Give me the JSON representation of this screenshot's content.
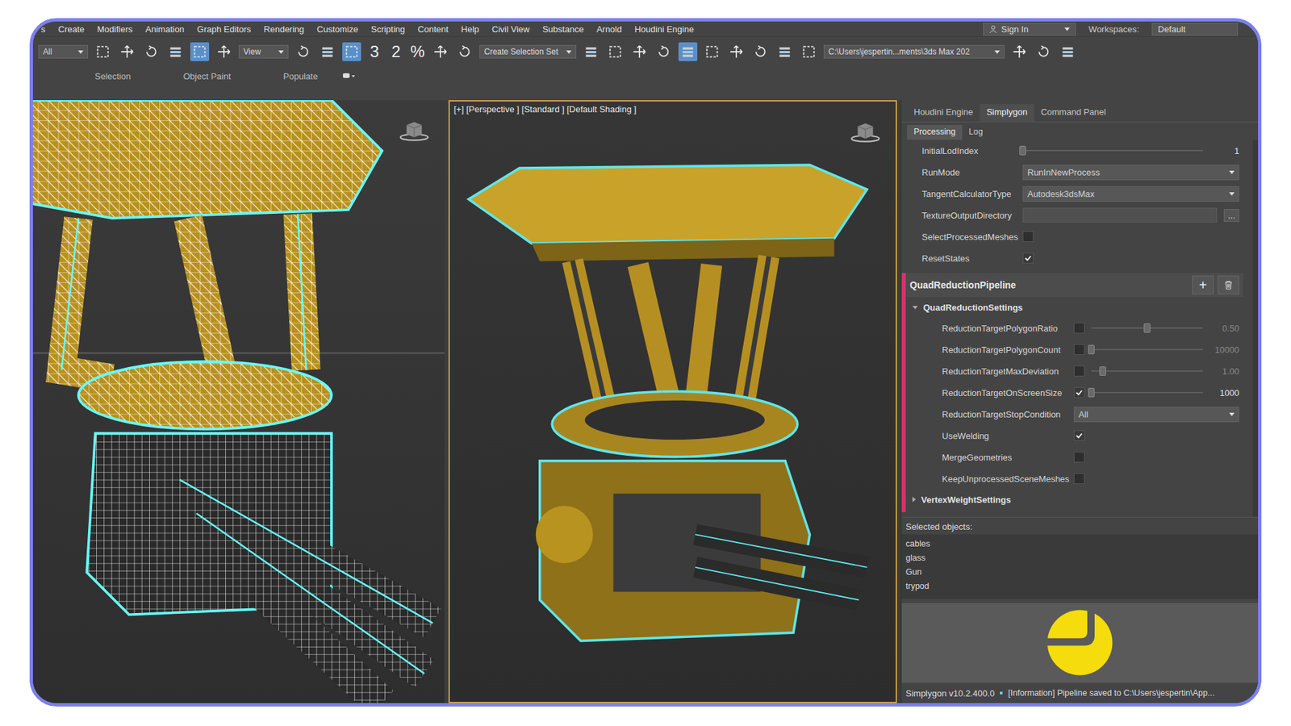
{
  "menu": [
    "s",
    "Create",
    "Modifiers",
    "Animation",
    "Graph Editors",
    "Rendering",
    "Customize",
    "Scripting",
    "Content",
    "Help",
    "Civil View",
    "Substance",
    "Arnold",
    "Houdini Engine"
  ],
  "account": {
    "sign_in": "Sign In",
    "workspaces_label": "Workspaces:",
    "workspace": "Default"
  },
  "toolbar": {
    "filter": "All",
    "view": "View",
    "selection_set": "Create Selection Set",
    "snaps": [
      "3",
      "2",
      "%"
    ],
    "path": "C:\\Users\\jespertin...ments\\3ds Max 202"
  },
  "tools": [
    {
      "selected": false
    },
    {
      "selected": false
    },
    {
      "selected": false
    },
    {
      "selected": false
    },
    {
      "selected": true
    },
    {
      "selected": false
    },
    {
      "selected": false
    },
    {
      "selected": false
    },
    {
      "selected": true
    },
    {
      "selected": false
    },
    {
      "selected": false
    },
    {
      "selected": false
    },
    {
      "selected": false
    },
    {
      "selected": false
    },
    {
      "selected": false
    },
    {
      "selected": true
    },
    {
      "selected": false
    },
    {
      "selected": false
    },
    {
      "selected": false
    },
    {
      "selected": false
    },
    {
      "selected": false
    },
    {
      "selected": false
    },
    {
      "selected": false
    },
    {
      "selected": false
    }
  ],
  "ribbon": [
    "Selection",
    "Object Paint",
    "Populate"
  ],
  "viewports": [
    {
      "kind": "wireframe",
      "active": false,
      "label": ""
    },
    {
      "kind": "shaded",
      "active": true,
      "label": "[+] [Perspective ] [Standard ] [Default Shading ]"
    }
  ],
  "panel": {
    "tabs": [
      {
        "label": "Houdini Engine",
        "selected": false
      },
      {
        "label": "Simplygon",
        "selected": true
      },
      {
        "label": "Command Panel",
        "selected": false
      }
    ],
    "subtabs": [
      {
        "label": "Processing",
        "selected": true
      },
      {
        "label": "Log",
        "selected": false
      }
    ],
    "settings": [
      {
        "kind": "slider",
        "label": "InitialLodIndex",
        "level": 0,
        "reading": "1"
      },
      {
        "kind": "dropdown",
        "label": "RunMode",
        "value": "RunInNewProcess"
      },
      {
        "kind": "dropdown",
        "label": "TangentCalculatorType",
        "value": "Autodesk3dsMax"
      },
      {
        "kind": "path",
        "label": "TextureOutputDirectory",
        "value": "",
        "button": "..."
      },
      {
        "kind": "check",
        "label": "SelectProcessedMeshes",
        "checked": false
      },
      {
        "kind": "check",
        "label": "ResetStates",
        "checked": true
      }
    ],
    "pipeline": {
      "title": "QuadReductionPipeline",
      "add": "+",
      "section": {
        "title": "QuadReductionSettings",
        "expanded": true,
        "rows": [
          {
            "kind": "checkslider",
            "label": "ReductionTargetPolygonRatio",
            "checked": false,
            "level": 0.5,
            "reading": "0.50"
          },
          {
            "kind": "checkslider",
            "label": "ReductionTargetPolygonCount",
            "checked": false,
            "level": 0.0,
            "reading": "10000"
          },
          {
            "kind": "checkslider",
            "label": "ReductionTargetMaxDeviation",
            "checked": false,
            "level": 0.1,
            "reading": "1.00"
          },
          {
            "kind": "checkslider",
            "label": "ReductionTargetOnScreenSize",
            "checked": true,
            "level": 0.0,
            "reading": "1000"
          },
          {
            "kind": "dropdown",
            "label": "ReductionTargetStopCondition",
            "value": "All"
          },
          {
            "kind": "check",
            "label": "UseWelding",
            "checked": true
          },
          {
            "kind": "check",
            "label": "MergeGeometries",
            "checked": false
          },
          {
            "kind": "check",
            "label": "KeepUnprocessedSceneMeshes",
            "checked": false
          }
        ]
      },
      "next_section": {
        "title": "VertexWeightSettings",
        "expanded": false
      }
    },
    "selected_objects": {
      "label": "Selected objects:",
      "items": [
        "cables",
        "glass",
        "Gun",
        "trypod"
      ]
    },
    "status": {
      "version": "Simplygon v10.2.400.0",
      "message": "[Information] Pipeline saved to C:\\Users\\jespertin\\App..."
    }
  }
}
